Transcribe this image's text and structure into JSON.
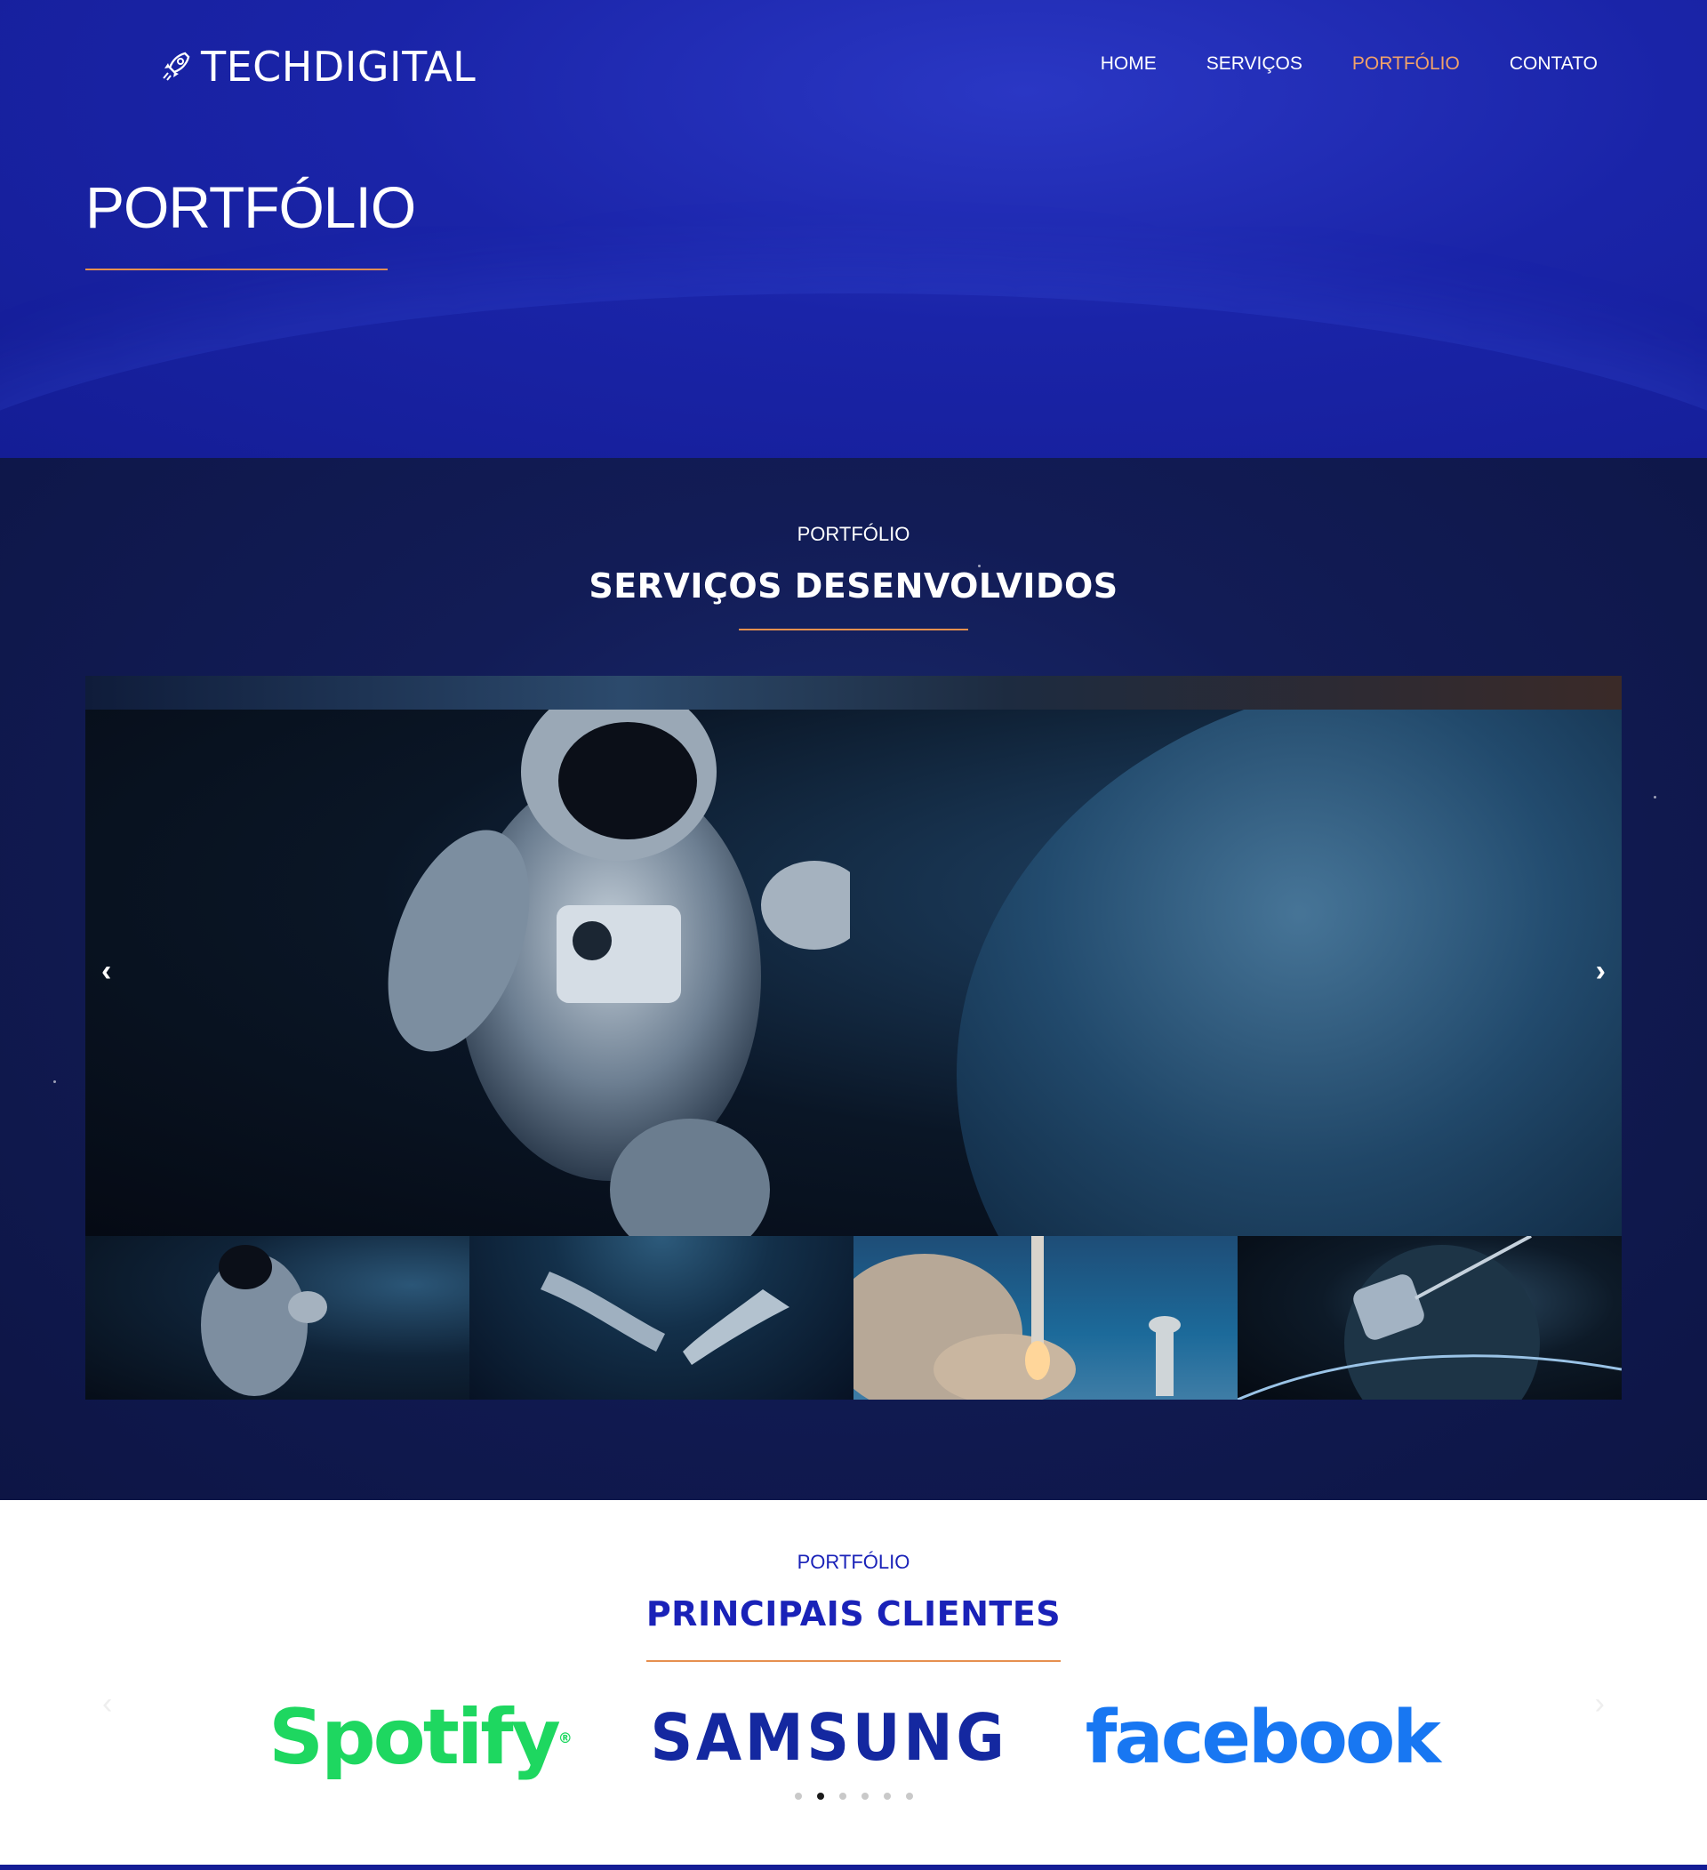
{
  "header": {
    "logo_text": "TECHDIGITAL",
    "nav": [
      {
        "label": "HOME",
        "active": false
      },
      {
        "label": "SERVIÇOS",
        "active": false
      },
      {
        "label": "PORTFÓLIO",
        "active": true
      },
      {
        "label": "CONTATO",
        "active": false
      }
    ],
    "page_title": "PORTFÓLIO"
  },
  "gallery_section": {
    "kicker": "PORTFÓLIO",
    "title": "SERVIÇOS DESENVOLVIDOS",
    "prev_icon": "‹",
    "next_icon": "›",
    "thumbnails": [
      "astronaut",
      "hands",
      "rocket-launch",
      "satellite"
    ]
  },
  "clients_section": {
    "kicker": "PORTFÓLIO",
    "title": "PRINCIPAIS CLIENTES",
    "clients": [
      "Spotify",
      "SAMSUNG",
      "facebook"
    ],
    "carousel_dots": 6,
    "active_dot": 1
  },
  "colors": {
    "hero_blue": "#1a24a8",
    "accent_orange": "#e6904f",
    "nav_active": "#f0a16a",
    "clients_title": "#1a22b8",
    "spotify_green": "#1ed760",
    "samsung_blue": "#1428a0",
    "facebook_blue": "#1877f2"
  }
}
